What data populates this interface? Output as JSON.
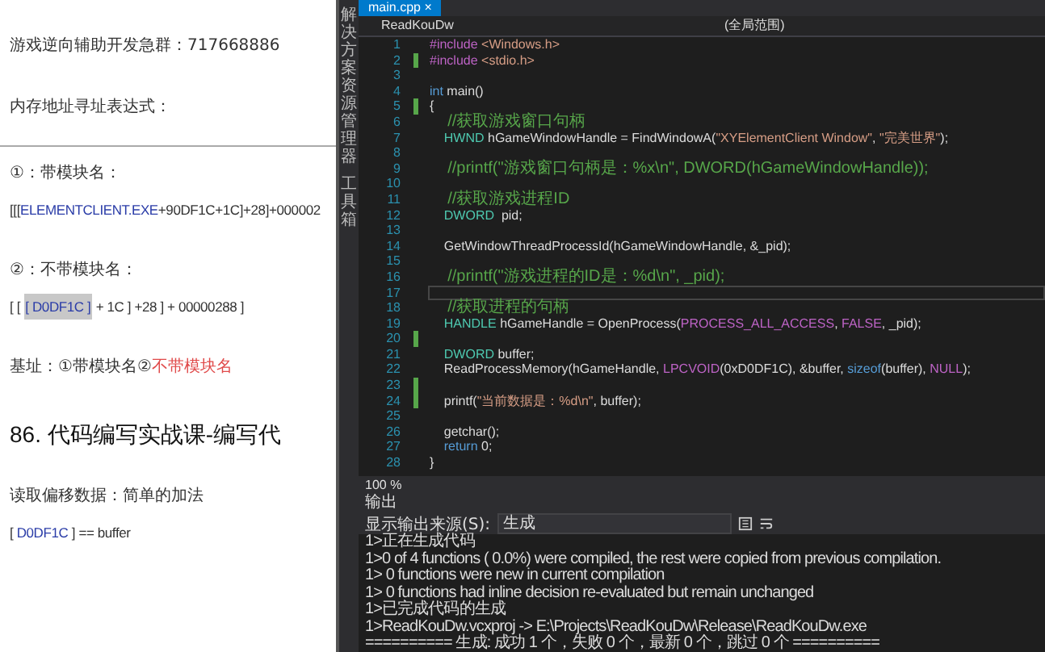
{
  "document": {
    "paragraphs": [
      {
        "kind": "text",
        "segments": [
          {
            "text": "游戏逆向辅助开发急群：717668886",
            "kind": "normal"
          }
        ]
      },
      {
        "kind": "text",
        "segments": [
          {
            "text": "内存地址寻址表达式：",
            "kind": "normal"
          }
        ]
      },
      {
        "kind": "rule"
      },
      {
        "kind": "text",
        "segments": [
          {
            "text": "①：带模块名：",
            "kind": "normal"
          }
        ]
      },
      {
        "kind": "expr",
        "segments": [
          {
            "text": "[[[",
            "kind": "normal"
          },
          {
            "text": "ELEMENTCLIENT.EXE",
            "kind": "blue"
          },
          {
            "text": "+90DF1C+1C]+28]+000002",
            "kind": "normal"
          }
        ]
      },
      {
        "kind": "text",
        "segments": [
          {
            "text": "②：不带模块名：",
            "kind": "normal"
          }
        ]
      },
      {
        "kind": "expr",
        "segments": [
          {
            "text": "[ [ ",
            "kind": "normal"
          },
          {
            "text": "[ D0DF1C ]",
            "kind": "highlight"
          },
          {
            "text": " + 1C ] +28 ] + 00000288 ]",
            "kind": "normal"
          }
        ]
      },
      {
        "kind": "text",
        "segments": [
          {
            "text": "基址：①带模块名②",
            "kind": "normal"
          },
          {
            "text": "不带模块名",
            "kind": "red"
          }
        ]
      },
      {
        "kind": "heading",
        "segments": [
          {
            "text": "86. 代码编写实战课-编写代",
            "kind": "normal"
          }
        ]
      },
      {
        "kind": "text",
        "segments": [
          {
            "text": "读取偏移数据：简单的加法",
            "kind": "normal"
          }
        ]
      },
      {
        "kind": "expr",
        "segments": [
          {
            "text": " [ ",
            "kind": "normal"
          },
          {
            "text": "D0DF1C",
            "kind": "blue"
          },
          {
            "text": " ]    == buffer",
            "kind": "normal"
          }
        ]
      }
    ]
  },
  "ide": {
    "side_tabs": [
      "解决方案资源管理器",
      "工具箱"
    ],
    "file_tab": {
      "label": "main.cpp",
      "close": "×",
      "selected": true
    },
    "nav": {
      "project": "ReadKouDw",
      "scope": "(全局范围)"
    },
    "lines": [
      {
        "number": "1",
        "changed": false,
        "current": false,
        "tokens": [
          {
            "text": "#include",
            "kind": "macro"
          },
          {
            "text": " <Windows.h>",
            "kind": "string"
          }
        ]
      },
      {
        "number": "2",
        "changed": true,
        "current": false,
        "tokens": [
          {
            "text": "#include",
            "kind": "macro"
          },
          {
            "text": " <stdio.h>",
            "kind": "string"
          }
        ]
      },
      {
        "number": "3",
        "changed": false,
        "current": false
      },
      {
        "number": "4",
        "changed": false,
        "current": false,
        "tokens": [
          {
            "text": "int",
            "kind": "keyword"
          },
          {
            "text": " main()",
            "kind": "plain"
          }
        ]
      },
      {
        "number": "5",
        "changed": true,
        "current": false,
        "tokens": [
          {
            "text": "{",
            "kind": "plain"
          }
        ]
      },
      {
        "number": "6",
        "changed": false,
        "current": false,
        "tokens": [
          {
            "text": "    //获取游戏窗口句柄",
            "kind": "comment"
          }
        ]
      },
      {
        "number": "7",
        "changed": false,
        "current": false,
        "tokens": [
          {
            "text": "    HWND",
            "kind": "type"
          },
          {
            "text": " hGameWindowHandle = FindWindowA(",
            "kind": "plain"
          },
          {
            "text": "\"XYElementClient Window\"",
            "kind": "string"
          },
          {
            "text": ", ",
            "kind": "plain"
          },
          {
            "text": "\"完美世界\"",
            "kind": "string"
          },
          {
            "text": ");",
            "kind": "plain"
          }
        ]
      },
      {
        "number": "8",
        "changed": false,
        "current": false
      },
      {
        "number": "9",
        "changed": false,
        "current": false,
        "tokens": [
          {
            "text": "    //printf(\"游戏窗口句柄是：%x\\n\", DWORD(hGameWindowHandle));",
            "kind": "comment"
          }
        ]
      },
      {
        "number": "10",
        "changed": false,
        "current": false
      },
      {
        "number": "11",
        "changed": false,
        "current": false,
        "tokens": [
          {
            "text": "    //获取游戏进程ID",
            "kind": "comment"
          }
        ]
      },
      {
        "number": "12",
        "changed": false,
        "current": false,
        "tokens": [
          {
            "text": "    DWORD",
            "kind": "type"
          },
          {
            "text": "  pid;",
            "kind": "plain"
          }
        ]
      },
      {
        "number": "13",
        "changed": false,
        "current": false
      },
      {
        "number": "14",
        "changed": false,
        "current": false,
        "tokens": [
          {
            "text": "    GetWindowThreadProcessId(hGameWindowHandle, &_pid);",
            "kind": "plain"
          }
        ]
      },
      {
        "number": "15",
        "changed": false,
        "current": false
      },
      {
        "number": "16",
        "changed": false,
        "current": false,
        "tokens": [
          {
            "text": "    //printf(\"游戏进程的ID是：%d\\n\", _pid);",
            "kind": "comment"
          }
        ]
      },
      {
        "number": "17",
        "changed": false,
        "current": true
      },
      {
        "number": "18",
        "changed": false,
        "current": false,
        "tokens": [
          {
            "text": "    //获取进程的句柄",
            "kind": "comment"
          }
        ]
      },
      {
        "number": "19",
        "changed": false,
        "current": false,
        "tokens": [
          {
            "text": "    HANDLE",
            "kind": "type"
          },
          {
            "text": " hGameHandle = OpenProcess(",
            "kind": "plain"
          },
          {
            "text": "PROCESS_ALL_ACCESS",
            "kind": "macro"
          },
          {
            "text": ", ",
            "kind": "plain"
          },
          {
            "text": "FALSE",
            "kind": "macro"
          },
          {
            "text": ", _pid);",
            "kind": "plain"
          }
        ]
      },
      {
        "number": "20",
        "changed": true,
        "current": false
      },
      {
        "number": "21",
        "changed": false,
        "current": false,
        "tokens": [
          {
            "text": "    DWORD",
            "kind": "type"
          },
          {
            "text": " buffer;",
            "kind": "plain"
          }
        ]
      },
      {
        "number": "22",
        "changed": false,
        "current": false,
        "tokens": [
          {
            "text": "    ReadProcessMemory(hGameHandle, ",
            "kind": "plain"
          },
          {
            "text": "LPCVOID",
            "kind": "macro"
          },
          {
            "text": "(0xD0DF1C), &buffer, ",
            "kind": "plain"
          },
          {
            "text": "sizeof",
            "kind": "keyword"
          },
          {
            "text": "(buffer), ",
            "kind": "plain"
          },
          {
            "text": "NULL",
            "kind": "macro"
          },
          {
            "text": ");",
            "kind": "plain"
          }
        ]
      },
      {
        "number": "23",
        "changed": true,
        "current": false
      },
      {
        "number": "24",
        "changed": true,
        "current": false,
        "tokens": [
          {
            "text": "    printf(",
            "kind": "plain"
          },
          {
            "text": "\"当前数据是：%d\\n\"",
            "kind": "string"
          },
          {
            "text": ", buffer);",
            "kind": "plain"
          }
        ]
      },
      {
        "number": "25",
        "changed": false,
        "current": false
      },
      {
        "number": "26",
        "changed": false,
        "current": false,
        "tokens": [
          {
            "text": "    getchar();",
            "kind": "plain"
          }
        ]
      },
      {
        "number": "27",
        "changed": false,
        "current": false,
        "tokens": [
          {
            "text": "    return",
            "kind": "keyword"
          },
          {
            "text": " 0;",
            "kind": "plain"
          }
        ]
      },
      {
        "number": "28",
        "changed": false,
        "current": false,
        "tokens": [
          {
            "text": "}",
            "kind": "plain"
          }
        ]
      }
    ],
    "zoom": "100 %",
    "output": {
      "title": "输出",
      "source_label": "显示输出来源(S):",
      "source": "生成",
      "lines": [
        "1>正在生成代码",
        "1>0 of 4 functions ( 0.0%) were compiled, the rest were copied from previous compilation.",
        "1>  0 functions were new in current compilation",
        "1>  0 functions had inline decision re-evaluated but remain unchanged",
        "1>已完成代码的生成",
        "1>ReadKouDw.vcxproj -> E:\\Projects\\ReadKouDw\\Release\\ReadKouDw.exe",
        "========== 生成: 成功 1 个，失败 0 个，最新 0 个，跳过 0 个 =========="
      ]
    }
  }
}
